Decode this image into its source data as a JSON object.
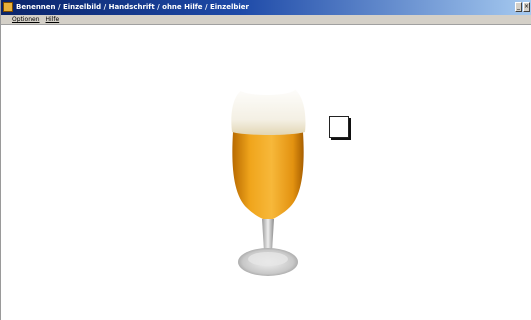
{
  "window": {
    "title": "Benennen / Einzelbild / Handschrift / ohne Hilfe / Einzelbier",
    "controls": [
      "minimize",
      "close"
    ]
  },
  "menu": {
    "items": [
      {
        "label": "Optionen"
      },
      {
        "label": "Hilfe"
      }
    ]
  },
  "content": {
    "picture": "beer-glass",
    "answer_box": "empty handwriting box"
  },
  "icons": {
    "app": "app-icon",
    "minimize": "minimize-icon",
    "close": "close-icon"
  }
}
